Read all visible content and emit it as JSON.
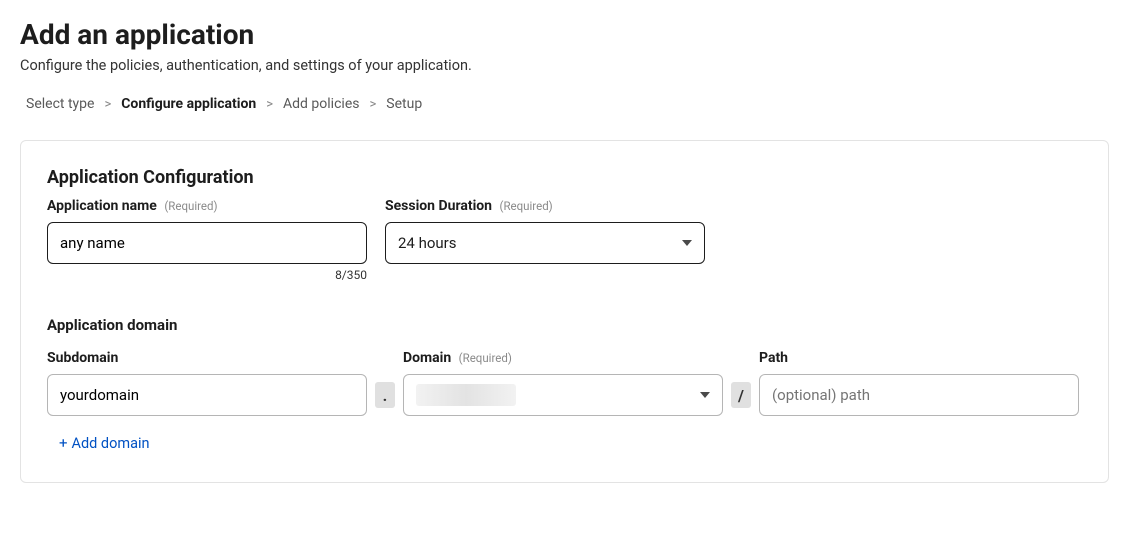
{
  "page": {
    "title": "Add an application",
    "subtitle": "Configure the policies, authentication, and settings of your application."
  },
  "breadcrumb": {
    "steps": [
      {
        "label": "Select type",
        "active": false
      },
      {
        "label": "Configure application",
        "active": true
      },
      {
        "label": "Add policies",
        "active": false
      },
      {
        "label": "Setup",
        "active": false
      }
    ],
    "separator": ">"
  },
  "config": {
    "section_title": "Application Configuration",
    "app_name": {
      "label": "Application name",
      "required_text": "(Required)",
      "value": "any name",
      "counter": "8/350"
    },
    "session": {
      "label": "Session Duration",
      "required_text": "(Required)",
      "value": "24 hours"
    },
    "domain_section": {
      "section_label": "Application domain",
      "subdomain": {
        "label": "Subdomain",
        "value": "yourdomain"
      },
      "domain": {
        "label": "Domain",
        "required_text": "(Required)",
        "value": ""
      },
      "path": {
        "label": "Path",
        "placeholder": "(optional) path",
        "value": ""
      },
      "dot": ".",
      "slash": "/",
      "add_domain_label": "Add domain"
    }
  }
}
